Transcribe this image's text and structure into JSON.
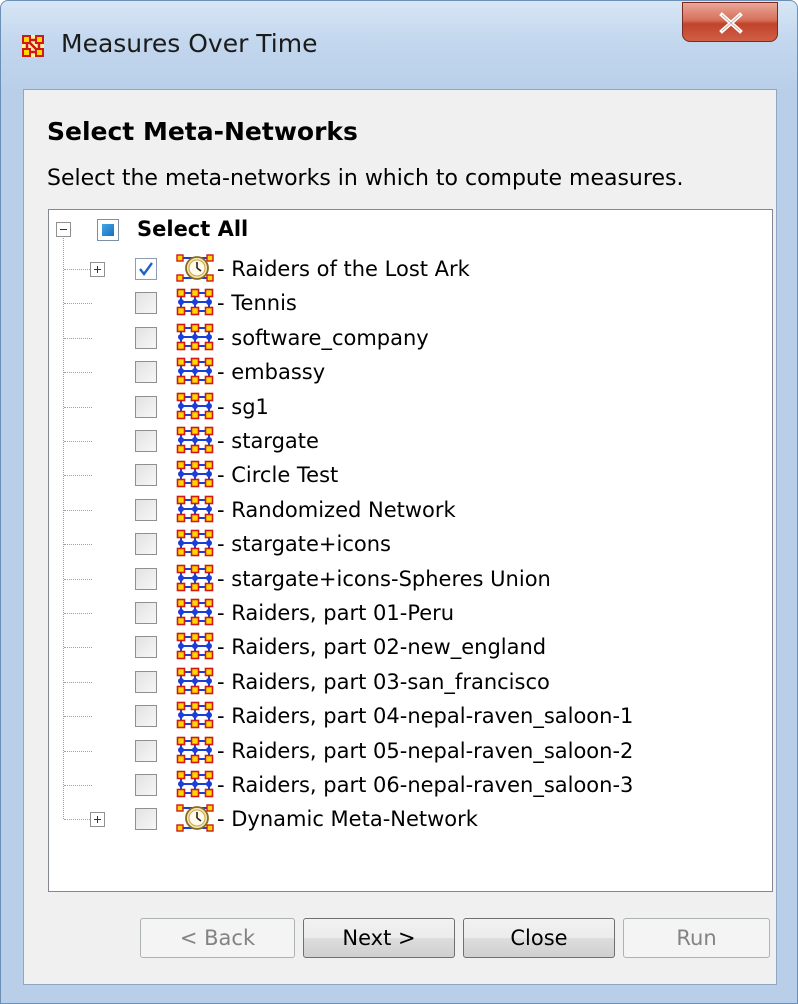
{
  "window": {
    "title": "Measures Over Time",
    "icon": "meta-network-icon",
    "close_glyph": "X"
  },
  "heading": "Select Meta-Networks",
  "description": "Select the meta-networks in which to compute measures.",
  "tree": {
    "root": {
      "label": "Select All",
      "state": "partial",
      "expanded": true
    },
    "items": [
      {
        "label": "Raiders of the Lost Ark",
        "checked": true,
        "icon": "dynamic-meta-network-icon",
        "expandable": true
      },
      {
        "label": "Tennis",
        "checked": false,
        "icon": "meta-network-icon"
      },
      {
        "label": "software_company",
        "checked": false,
        "icon": "meta-network-icon"
      },
      {
        "label": "embassy",
        "checked": false,
        "icon": "meta-network-icon"
      },
      {
        "label": "sg1",
        "checked": false,
        "icon": "meta-network-icon"
      },
      {
        "label": "stargate",
        "checked": false,
        "icon": "meta-network-icon"
      },
      {
        "label": "Circle Test",
        "checked": false,
        "icon": "meta-network-icon"
      },
      {
        "label": "Randomized Network",
        "checked": false,
        "icon": "meta-network-icon"
      },
      {
        "label": "stargate+icons",
        "checked": false,
        "icon": "meta-network-icon"
      },
      {
        "label": "stargate+icons-Spheres Union",
        "checked": false,
        "icon": "meta-network-icon"
      },
      {
        "label": "Raiders, part 01-Peru",
        "checked": false,
        "icon": "meta-network-icon"
      },
      {
        "label": "Raiders, part 02-new_england",
        "checked": false,
        "icon": "meta-network-icon"
      },
      {
        "label": "Raiders, part 03-san_francisco",
        "checked": false,
        "icon": "meta-network-icon"
      },
      {
        "label": "Raiders, part 04-nepal-raven_saloon-1",
        "checked": false,
        "icon": "meta-network-icon"
      },
      {
        "label": "Raiders, part 05-nepal-raven_saloon-2",
        "checked": false,
        "icon": "meta-network-icon"
      },
      {
        "label": "Raiders, part 06-nepal-raven_saloon-3",
        "checked": false,
        "icon": "meta-network-icon"
      },
      {
        "label": "Dynamic Meta-Network",
        "checked": false,
        "icon": "dynamic-meta-network-icon",
        "expandable": true
      }
    ]
  },
  "buttons": {
    "back": {
      "label": "< Back",
      "enabled": false
    },
    "next": {
      "label": "Next >",
      "enabled": true
    },
    "close": {
      "label": "Close",
      "enabled": true
    },
    "run": {
      "label": "Run",
      "enabled": false
    }
  },
  "colors": {
    "node_blue": "#1a3fd6",
    "node_red": "#d01818",
    "node_yellow": "#ffd800",
    "check_blue": "#1e64c8"
  }
}
